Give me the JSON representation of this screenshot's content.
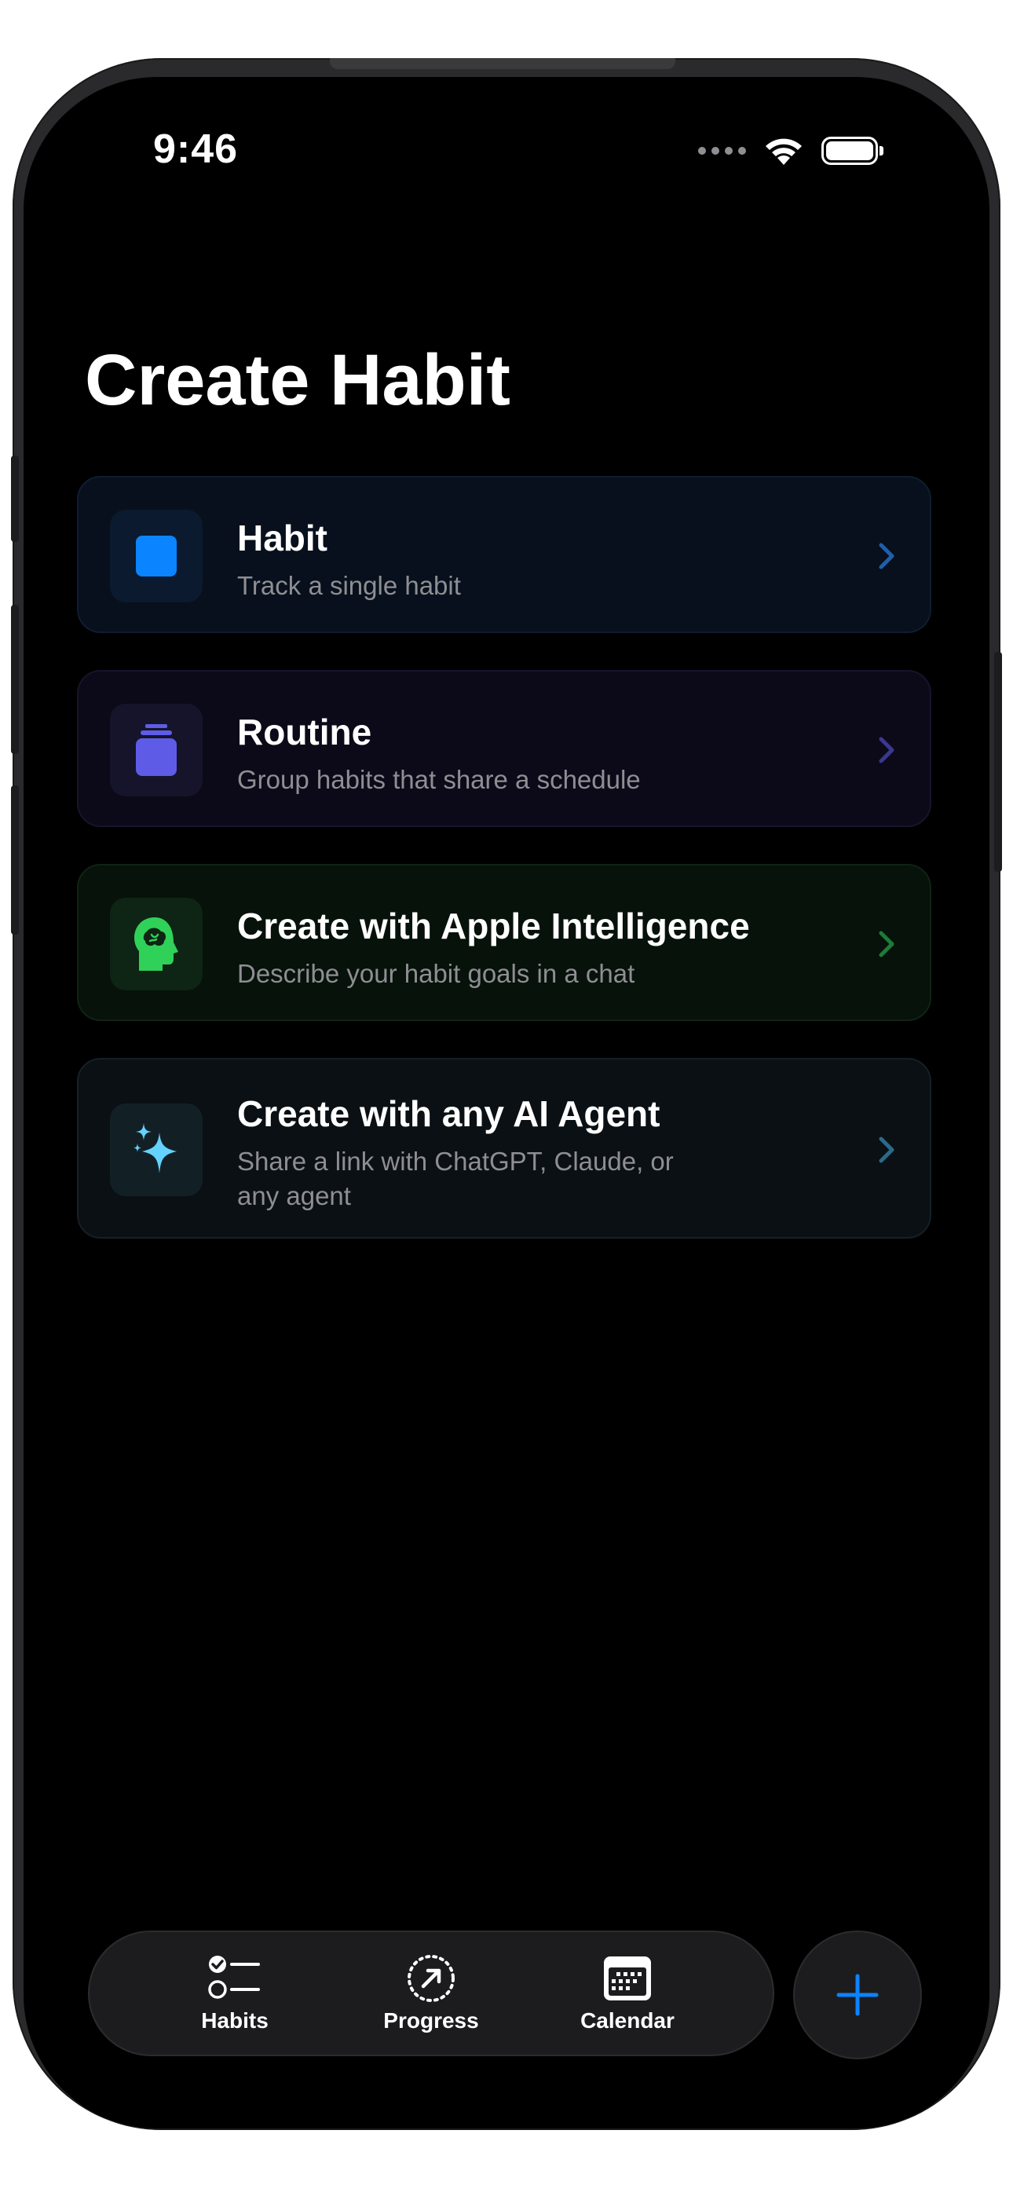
{
  "status_bar": {
    "time": "9:46"
  },
  "page": {
    "title": "Create Habit"
  },
  "options": [
    {
      "id": "habit",
      "title": "Habit",
      "subtitle": "Track a single habit",
      "icon": "square-icon",
      "accent": "#0a84ff"
    },
    {
      "id": "routine",
      "title": "Routine",
      "subtitle": "Group habits that share a schedule",
      "icon": "stack-icon",
      "accent": "#5e5ce6"
    },
    {
      "id": "apple-intelligence",
      "title": "Create with Apple Intelligence",
      "subtitle": "Describe your habit goals in a chat",
      "icon": "brain-head-icon",
      "accent": "#30d158"
    },
    {
      "id": "ai-agent",
      "title": "Create with any AI Agent",
      "subtitle": "Share a link with ChatGPT, Claude, or any agent",
      "icon": "sparkles-icon",
      "accent": "#64d2ff"
    }
  ],
  "tab_bar": {
    "tabs": [
      {
        "label": "Habits",
        "icon": "checklist-icon"
      },
      {
        "label": "Progress",
        "icon": "progress-arrow-icon"
      },
      {
        "label": "Calendar",
        "icon": "calendar-icon"
      }
    ],
    "add_button_icon": "plus-icon",
    "accent": "#0a84ff"
  }
}
